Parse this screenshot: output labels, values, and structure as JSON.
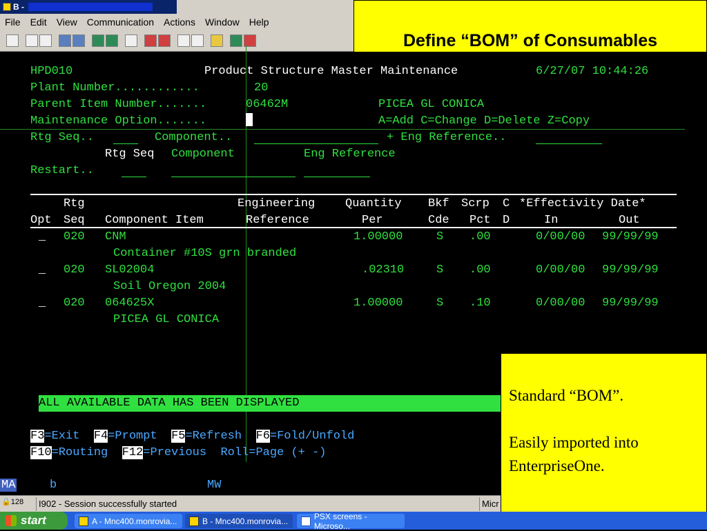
{
  "window": {
    "title": "B -"
  },
  "menu": [
    "File",
    "Edit",
    "View",
    "Communication",
    "Actions",
    "Window",
    "Help"
  ],
  "callout_top": {
    "heading": "Define “BOM” of Consumables"
  },
  "callout_bottom": {
    "line1": "Standard “BOM”.",
    "line2a": "Easily imported into",
    "line2b": "EnterpriseOne."
  },
  "screen": {
    "program": "HPD010",
    "title": "Product Structure Master Maintenance",
    "datetime": "6/27/07 10:44:26",
    "plant_label": "Plant Number............",
    "plant_value": "20",
    "parent_label": "Parent Item Number.......",
    "parent_value": "06462M",
    "parent_desc": "PICEA GL CONICA",
    "maint_label": "Maintenance Option.......",
    "maint_hint": "A=Add C=Change D=Delete Z=Copy",
    "rtg_label": "Rtg Seq..",
    "comp_label": "Component..",
    "engref_label": "+ Eng Reference..",
    "sub_rtg": "Rtg Seq",
    "sub_comp": "Component",
    "sub_eng": "Eng Reference",
    "restart_label": "Restart..",
    "col_h1": {
      "rtg": "Rtg",
      "eng": "Engineering",
      "qty": "Quantity",
      "bkf": "Bkf",
      "scrp": "Scrp",
      "c": "C",
      "eff": "*Effectivity Date*"
    },
    "col_h2": {
      "opt": "Opt",
      "seq": "Seq",
      "comp": "Component Item",
      "ref": "Reference",
      "per": "Per",
      "cde": "Cde",
      "pct": "Pct",
      "d": "D",
      "in": "In",
      "out": "Out"
    },
    "rows": [
      {
        "opt": "_",
        "seq": "020",
        "item": "CNM",
        "qty": "1.00000",
        "bkf": "S",
        "scrp": ".00",
        "in": "0/00/00",
        "out": "99/99/99",
        "desc": "Container #10S grn branded"
      },
      {
        "opt": "_",
        "seq": "020",
        "item": "SL02004",
        "qty": ".02310",
        "bkf": "S",
        "scrp": ".00",
        "in": "0/00/00",
        "out": "99/99/99",
        "desc": "Soil Oregon 2004"
      },
      {
        "opt": "_",
        "seq": "020",
        "item": "064625X",
        "qty": "1.00000",
        "bkf": "S",
        "scrp": ".10",
        "in": "0/00/00",
        "out": "99/99/99",
        "desc": "PICEA GL CONICA"
      }
    ],
    "status_msg": "ALL AVAILABLE DATA HAS BEEN DISPLAYED",
    "fkeys1": [
      {
        "key": "F3",
        "label": "=Exit  "
      },
      {
        "key": "F4",
        "label": "=Prompt  "
      },
      {
        "key": "F5",
        "label": "=Refresh  "
      },
      {
        "key": "F6",
        "label": "=Fold/Unfold"
      }
    ],
    "fkeys2": [
      {
        "key": "F10",
        "label": "=Routing  "
      },
      {
        "key": "F12",
        "label": "=Previous  Roll=Page (+ -)"
      }
    ]
  },
  "oia": {
    "mode": "MA",
    "b": "b",
    "mw": "MW"
  },
  "statusbar": {
    "lock": "128",
    "message": "I902 - Session successfully started",
    "right": "Micr"
  },
  "taskbar": {
    "start": "start",
    "tasks": [
      "A - Mnc400.monrovia...",
      "B - Mnc400.monrovia...",
      "PSX screens - Microso..."
    ]
  }
}
